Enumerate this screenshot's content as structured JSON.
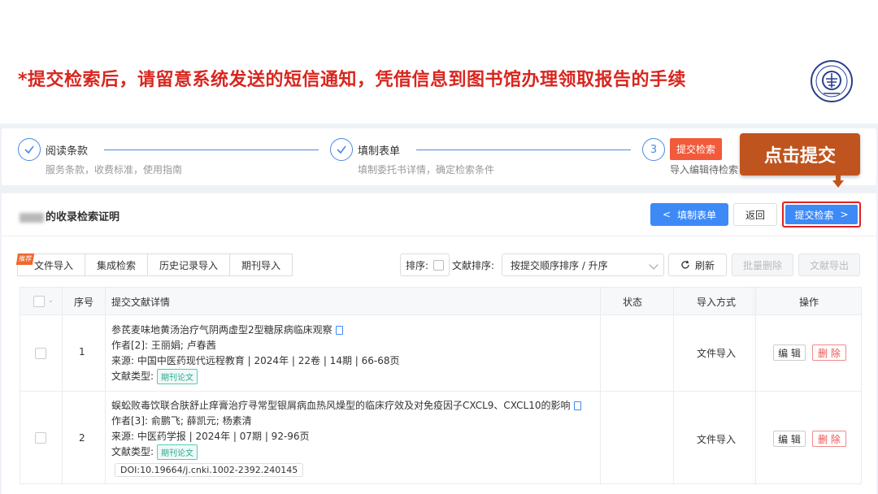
{
  "banner": {
    "notice": "*提交检索后，请留意系统发送的短信通知，凭借信息到图书馆办理领取报告的手续",
    "logo_icon": "library-seal-icon"
  },
  "steps": [
    {
      "num": "",
      "icon": "check-icon",
      "title": "阅读条款",
      "desc": "服务条款，收费标准，使用指南"
    },
    {
      "num": "",
      "icon": "check-icon",
      "title": "填制表单",
      "desc": "填制委托书详情，确定检索条件"
    },
    {
      "num": "3",
      "title": "提交检索",
      "desc": "导入编辑待检索"
    }
  ],
  "callout": {
    "text": "点击提交"
  },
  "card": {
    "title_suffix": "的收录检索证明",
    "buttons": {
      "fill_form": "填制表单",
      "back": "返回",
      "submit": "提交检索"
    }
  },
  "tabs": [
    {
      "label": "文件导入",
      "badge": "推荐"
    },
    {
      "label": "集成检索"
    },
    {
      "label": "历史记录导入"
    },
    {
      "label": "期刊导入"
    }
  ],
  "toolbar": {
    "sort_label": "排序:",
    "order_label": "文献排序:",
    "order_value": "按提交顺序排序 / 升序",
    "refresh": "刷新",
    "batch_delete": "批量删除",
    "export": "文献导出"
  },
  "table": {
    "headers": {
      "index": "序号",
      "detail": "提交文献详情",
      "status": "状态",
      "method": "导入方式",
      "action": "操作"
    },
    "rows": [
      {
        "index": "1",
        "title": "参芪麦味地黄汤治疗气阴两虚型2型糖尿病临床观察",
        "authors": "作者[2]:  王丽娟; 卢春茜",
        "source": "来源:  中国中医药现代远程教育 | 2024年 | 22卷 | 14期 | 66-68页",
        "type_label": "文献类型:",
        "type_tag": "期刊论文",
        "doi": "",
        "status": "",
        "method": "文件导入",
        "edit": "编 辑",
        "delete": "删 除"
      },
      {
        "index": "2",
        "title": "蜈蚣败毒饮联合肤舒止痒膏治疗寻常型银屑病血热风燥型的临床疗效及对免疫因子CXCL9、CXCL10的影响",
        "authors": "作者[3]:  俞鹏飞; 薛凯元; 杨素清",
        "source": "来源:  中医药学报 | 2024年 | 07期 | 92-96页",
        "type_label": "文献类型:",
        "type_tag": "期刊论文",
        "doi": "DOI:10.19664/j.cnki.1002-2392.240145",
        "status": "",
        "method": "文件导入",
        "edit": "编 辑",
        "delete": "删 除"
      }
    ]
  },
  "colors": {
    "accent": "#3d8af7",
    "danger": "#e02020",
    "callout": "#c0541f",
    "notice": "#d8261f"
  }
}
